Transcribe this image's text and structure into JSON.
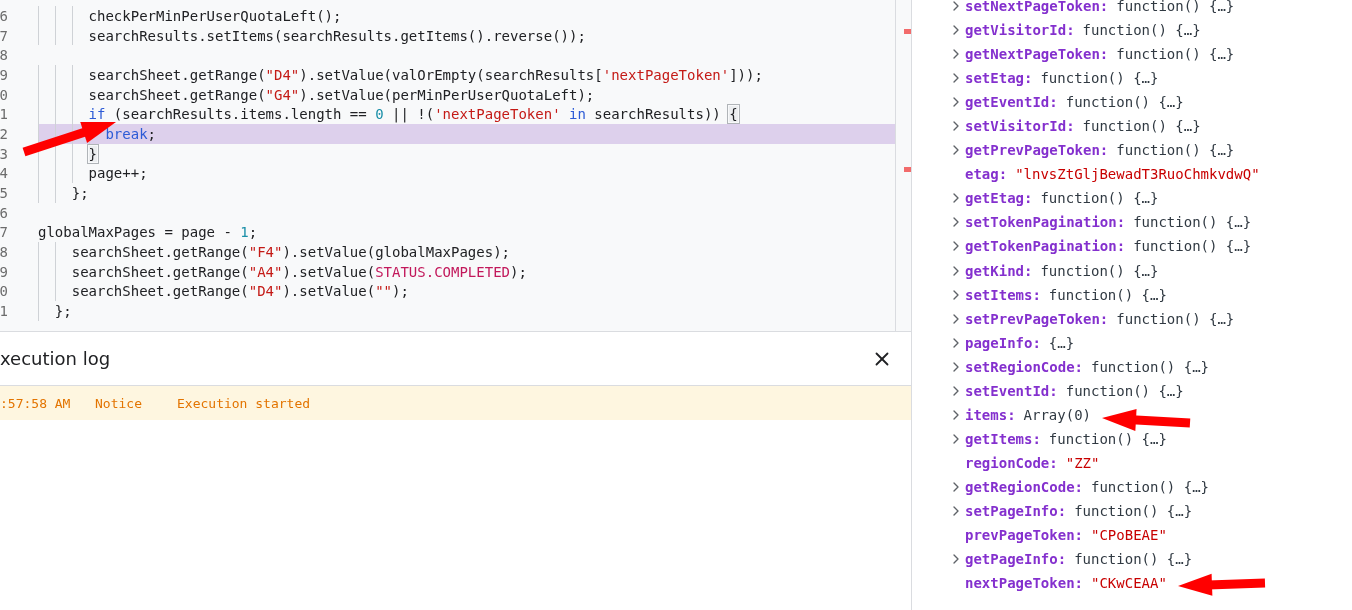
{
  "editor": {
    "lines": [
      {
        "children": [
          {
            "children": [
              {
                "children": [
                  {
                    "number": "6",
                    "highlighted": false,
                    "tokens": [
                      {
                        "kind": "plain",
                        "text": "checkPerMinPerUserQuotaLeft();"
                      }
                    ]
                  },
                  {
                    "number": "7",
                    "highlighted": false,
                    "tokens": [
                      {
                        "kind": "plain",
                        "text": "searchResults.setItems(searchResults.getItems().reverse());"
                      }
                    ]
                  },
                  {
                    "number": "8",
                    "highlighted": false
                  },
                  {
                    "number": "9",
                    "highlighted": false,
                    "tokens": [
                      {
                        "kind": "plain",
                        "text": "searchSheet.getRange("
                      },
                      {
                        "kind": "string",
                        "text": "\"D4\""
                      },
                      {
                        "kind": "plain",
                        "text": ").setValue(valOrEmpty(searchResults["
                      },
                      {
                        "kind": "string",
                        "text": "'nextPageToken'"
                      },
                      {
                        "kind": "plain",
                        "text": "]));"
                      }
                    ]
                  },
                  {
                    "number": "0",
                    "highlighted": false,
                    "tokens": [
                      {
                        "kind": "plain",
                        "text": "searchSheet.getRange("
                      },
                      {
                        "kind": "string",
                        "text": "\"G4\""
                      },
                      {
                        "kind": "plain",
                        "text": ").setValue(perMinPerUserQuotaLeft);"
                      }
                    ]
                  },
                  {
                    "number": "1",
                    "highlighted": false,
                    "tokens": [
                      {
                        "kind": "keyword",
                        "text": "if"
                      },
                      {
                        "kind": "plain",
                        "text": " (searchResults.items.length == "
                      },
                      {
                        "kind": "number",
                        "text": "0"
                      },
                      {
                        "kind": "plain",
                        "text": " || !("
                      },
                      {
                        "kind": "string",
                        "text": "'nextPageToken'"
                      },
                      {
                        "kind": "keyword",
                        "text": " in"
                      },
                      {
                        "kind": "plain",
                        "text": " searchResults)) "
                      },
                      {
                        "kind": "bracket",
                        "text": "{"
                      }
                    ],
                    "children": [
                      {
                        "number": "2",
                        "highlighted": true,
                        "tokens": [
                          {
                            "kind": "keyword",
                            "text": "break"
                          },
                          {
                            "kind": "plain",
                            "text": ";"
                          }
                        ]
                      }
                    ]
                  },
                  {
                    "number": "3",
                    "highlighted": false,
                    "tokens": [
                      {
                        "kind": "bracket",
                        "text": "}"
                      }
                    ]
                  },
                  {
                    "number": "4",
                    "highlighted": false,
                    "tokens": [
                      {
                        "kind": "plain",
                        "text": "page++;"
                      }
                    ]
                  }
                ]
              },
              {
                "number": "5",
                "highlighted": false,
                "tokens": [
                  {
                    "kind": "plain",
                    "text": "};"
                  }
                ]
              }
            ]
          }
        ]
      },
      {
        "number": "6",
        "highlighted": false
      },
      {
        "number": "7",
        "highlighted": false,
        "tokens": [
          {
            "kind": "plain",
            "text": "globalMaxPages = page - "
          },
          {
            "kind": "number",
            "text": "1"
          },
          {
            "kind": "plain",
            "text": ";"
          }
        ]
      },
      {
        "children": [
          {
            "children": [
              {
                "number": "8",
                "highlighted": false,
                "tokens": [
                  {
                    "kind": "plain",
                    "text": "searchSheet.getRange("
                  },
                  {
                    "kind": "string",
                    "text": "\"F4\""
                  },
                  {
                    "kind": "plain",
                    "text": ").setValue(globalMaxPages);"
                  }
                ]
              },
              {
                "number": "9",
                "highlighted": false,
                "tokens": [
                  {
                    "kind": "plain",
                    "text": "searchSheet.getRange("
                  },
                  {
                    "kind": "string",
                    "text": "\"A4\""
                  },
                  {
                    "kind": "plain",
                    "text": ").setValue("
                  },
                  {
                    "kind": "constant",
                    "text": "STATUS.COMPLETED"
                  },
                  {
                    "kind": "plain",
                    "text": ");"
                  }
                ]
              },
              {
                "number": "0",
                "highlighted": false,
                "tokens": [
                  {
                    "kind": "plain",
                    "text": "searchSheet.getRange("
                  },
                  {
                    "kind": "string",
                    "text": "\"D4\""
                  },
                  {
                    "kind": "plain",
                    "text": ").setValue("
                  },
                  {
                    "kind": "string",
                    "text": "\"\""
                  },
                  {
                    "kind": "plain",
                    "text": ");"
                  }
                ]
              }
            ]
          },
          {
            "number": "1",
            "highlighted": false,
            "tokens": [
              {
                "kind": "plain",
                "text": "};"
              }
            ]
          }
        ]
      }
    ]
  },
  "log": {
    "title": "xecution log",
    "entries": [
      {
        "time": ":57:58 AM",
        "level": "Notice",
        "message": "Execution started"
      }
    ]
  },
  "inspector": {
    "rows": [
      {
        "key": "setNextPageToken:",
        "value": "function() {…}",
        "kind": "plain",
        "expandable": true
      },
      {
        "key": "getVisitorId:",
        "value": "function() {…}",
        "kind": "plain",
        "expandable": true
      },
      {
        "key": "getNextPageToken:",
        "value": "function() {…}",
        "kind": "plain",
        "expandable": true
      },
      {
        "key": "setEtag:",
        "value": "function() {…}",
        "kind": "plain",
        "expandable": true
      },
      {
        "key": "getEventId:",
        "value": "function() {…}",
        "kind": "plain",
        "expandable": true
      },
      {
        "key": "setVisitorId:",
        "value": "function() {…}",
        "kind": "plain",
        "expandable": true
      },
      {
        "key": "getPrevPageToken:",
        "value": "function() {…}",
        "kind": "plain",
        "expandable": true
      },
      {
        "key": "etag:",
        "value": "\"lnvsZtGljBewadT3RuoChmkvdwQ\"",
        "kind": "string",
        "expandable": false
      },
      {
        "key": "getEtag:",
        "value": "function() {…}",
        "kind": "plain",
        "expandable": true
      },
      {
        "key": "setTokenPagination:",
        "value": "function() {…}",
        "kind": "plain",
        "expandable": true
      },
      {
        "key": "getTokenPagination:",
        "value": "function() {…}",
        "kind": "plain",
        "expandable": true
      },
      {
        "key": "getKind:",
        "value": "function() {…}",
        "kind": "plain",
        "expandable": true
      },
      {
        "key": "setItems:",
        "value": "function() {…}",
        "kind": "plain",
        "expandable": true
      },
      {
        "key": "setPrevPageToken:",
        "value": "function() {…}",
        "kind": "plain",
        "expandable": true
      },
      {
        "key": "pageInfo:",
        "value": "{…}",
        "kind": "plain",
        "expandable": true
      },
      {
        "key": "setRegionCode:",
        "value": "function() {…}",
        "kind": "plain",
        "expandable": true
      },
      {
        "key": "setEventId:",
        "value": "function() {…}",
        "kind": "plain",
        "expandable": true
      },
      {
        "key": "items:",
        "value": "Array(0)",
        "kind": "plain",
        "expandable": true
      },
      {
        "key": "getItems:",
        "value": "function() {…}",
        "kind": "plain",
        "expandable": true
      },
      {
        "key": "regionCode:",
        "value": "\"ZZ\"",
        "kind": "string",
        "expandable": false
      },
      {
        "key": "getRegionCode:",
        "value": "function() {…}",
        "kind": "plain",
        "expandable": true
      },
      {
        "key": "setPageInfo:",
        "value": "function() {…}",
        "kind": "plain",
        "expandable": true
      },
      {
        "key": "prevPageToken:",
        "value": "\"CPoBEAE\"",
        "kind": "string",
        "expandable": false
      },
      {
        "key": "getPageInfo:",
        "value": "function() {…}",
        "kind": "plain",
        "expandable": true
      },
      {
        "key": "nextPageToken:",
        "value": "\"CKwCEAA\"",
        "kind": "string",
        "expandable": false
      }
    ]
  }
}
